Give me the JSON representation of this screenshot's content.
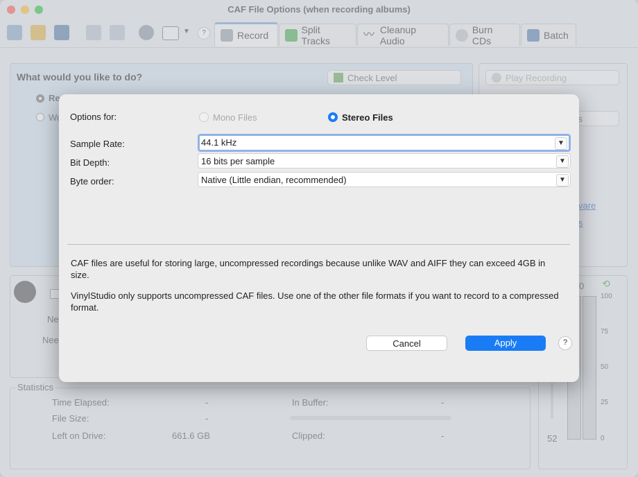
{
  "window": {
    "title": "CAF File Options (when recording albums)"
  },
  "toolbar": {
    "help_label": "?",
    "tabs": [
      {
        "label": "Record"
      },
      {
        "label": "Split Tracks"
      },
      {
        "label": "Cleanup Audio"
      },
      {
        "label": "Burn CDs"
      },
      {
        "label": "Batch"
      }
    ]
  },
  "background": {
    "question": "What would you like to do?",
    "option_1_partial": "Re",
    "option_2_partial": "Wo",
    "check_level": "Check Level",
    "play_recording": "Play Recording",
    "side_partial_s": "s",
    "link_partial_1": "vare",
    "link_partial_2": "s",
    "field_partial_1": "Nee",
    "field_partial_2": "Nee",
    "statistics": {
      "title": "Statistics",
      "time_elapsed_label": "Time Elapsed:",
      "time_elapsed_value": "-",
      "file_size_label": "File Size:",
      "file_size_value": "-",
      "left_on_drive_label": "Left on Drive:",
      "left_on_drive_value": "661.6 GB",
      "in_buffer_label": "In Buffer:",
      "in_buffer_value": "-",
      "clipped_label": "Clipped:",
      "clipped_value": "-"
    },
    "meter": {
      "top_partial": "0",
      "scale": [
        "100",
        "75",
        "50",
        "25",
        "0"
      ],
      "slider_value": "52"
    }
  },
  "dialog": {
    "options_for_label": "Options for:",
    "mono_label": "Mono Files",
    "stereo_label": "Stereo Files",
    "selected_mode": "stereo",
    "sample_rate_label": "Sample Rate:",
    "sample_rate_value": "44.1 kHz",
    "bit_depth_label": "Bit Depth:",
    "bit_depth_value": "16 bits per sample",
    "byte_order_label": "Byte order:",
    "byte_order_value": "Native (Little endian, recommended)",
    "para1": "CAF files are useful for storing large, uncompressed recordings because unlike WAV and AIFF they can exceed 4GB in size.",
    "para2": "VinylStudio only supports uncompressed CAF files.  Use one of the other file formats if you want to record to a compressed format.",
    "cancel_label": "Cancel",
    "apply_label": "Apply",
    "help_label": "?"
  },
  "colors": {
    "accent": "#1a7cf5",
    "close": "#ff5f57",
    "minimize": "#febc2e",
    "zoom": "#28c840"
  }
}
